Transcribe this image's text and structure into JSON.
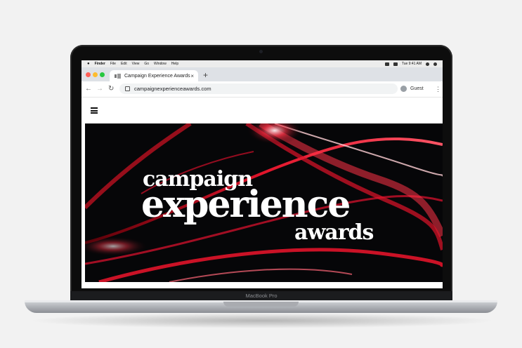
{
  "menubar": {
    "items": [
      "Finder",
      "File",
      "Edit",
      "View",
      "Go",
      "Window",
      "Help"
    ],
    "clock": "Tue 9:41 AM"
  },
  "browser": {
    "tab_title": "Campaign Experience Awards",
    "tab_close": "×",
    "new_tab": "+",
    "url": "campaignexperienceawards.com",
    "profile": "Guest",
    "back": "←",
    "forward": "→",
    "reload": "↻",
    "menu": "⋮"
  },
  "hero": {
    "line1": "campaign",
    "line2": "experience",
    "line3": "awards"
  },
  "laptop": {
    "brand": "MacBook Pro"
  },
  "colors": {
    "hero_bg": "#060608",
    "accent_red": "#e0142a"
  },
  "icons": [
    "apple-icon",
    "wifi-icon",
    "battery-icon",
    "search-icon",
    "lock-icon",
    "hamburger-icon",
    "guest-avatar-icon"
  ]
}
